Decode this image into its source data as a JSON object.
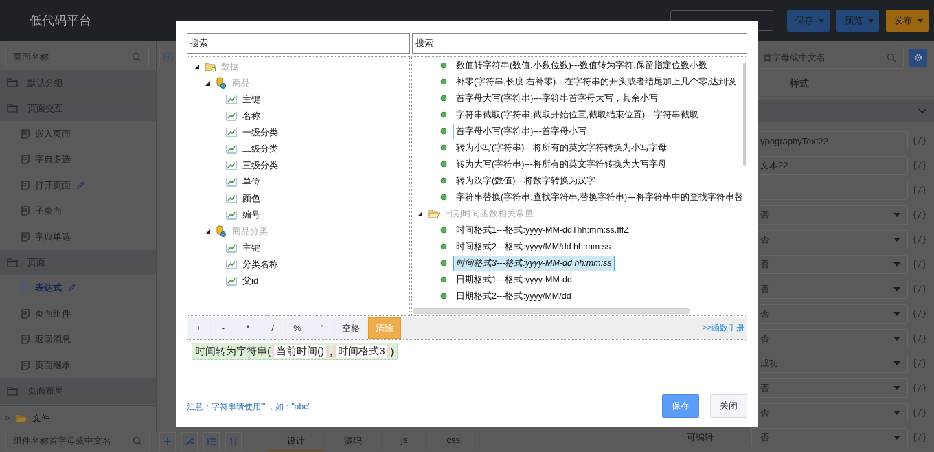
{
  "app": {
    "title": "低代码平台",
    "actions": [
      {
        "label": "保存",
        "kind": "primary"
      },
      {
        "label": "预览",
        "kind": "primary"
      },
      {
        "label": "发布",
        "kind": "warning"
      }
    ]
  },
  "sidebar": {
    "search_placeholder": "页面名称",
    "groups": [
      {
        "label": "默认分组"
      },
      {
        "label": "页面交互",
        "children": [
          {
            "label": "嵌入页面",
            "selected": false,
            "editing": false
          },
          {
            "label": "字典多选",
            "selected": false,
            "editing": false
          },
          {
            "label": "打开页面",
            "selected": false,
            "editing": true
          },
          {
            "label": "子页面",
            "selected": false,
            "editing": false
          },
          {
            "label": "字典单选",
            "selected": false,
            "editing": false
          }
        ]
      },
      {
        "label": "页面",
        "children": [
          {
            "label": "表达式",
            "selected": true,
            "editing": true
          },
          {
            "label": "页面组件",
            "selected": false,
            "editing": false
          },
          {
            "label": "返回消息",
            "selected": false,
            "editing": false
          },
          {
            "label": "页面继承",
            "selected": false,
            "editing": false
          }
        ]
      },
      {
        "label": "页面布局"
      }
    ],
    "file_node": {
      "label": "文件",
      "expanded": false
    },
    "component_search_placeholder": "组件名称首字母或中文名"
  },
  "editor_tabs": [
    {
      "label": "设计",
      "selected": true
    },
    {
      "label": "源码",
      "selected": false
    },
    {
      "label": "js",
      "selected": false
    },
    {
      "label": "css",
      "selected": false
    }
  ],
  "properties": {
    "search_placeholder": "首字母或中文名",
    "tabs": [
      {
        "label": "样式",
        "selected": false
      }
    ],
    "fields": [
      {
        "kind": "text",
        "value": "ypographyText22",
        "code_mark": "{/}"
      },
      {
        "kind": "text",
        "value": "文本22",
        "code_mark": "{/}"
      },
      {
        "kind": "text",
        "code_mark": "{/}"
      },
      {
        "kind": "select",
        "value": "否",
        "code_mark": "{/}"
      },
      {
        "kind": "select",
        "value": "否",
        "code_mark": "{/}"
      },
      {
        "kind": "select",
        "value": "否",
        "code_mark": "{/}"
      },
      {
        "kind": "select",
        "value": "否",
        "code_mark": "{/}"
      },
      {
        "kind": "select",
        "value": "否",
        "code_mark": "{/}"
      },
      {
        "kind": "select",
        "value": "否",
        "code_mark": "{/}"
      },
      {
        "kind": "select",
        "value": "成功",
        "code_mark": "{/}"
      },
      {
        "kind": "select",
        "value": "否",
        "code_mark": "{/}"
      },
      {
        "kind": "select",
        "value": "否",
        "code_mark": "{/}"
      },
      {
        "kind": "select",
        "label": "可编辑",
        "value": "否",
        "code_mark": "{/}"
      }
    ]
  },
  "dialog": {
    "left_search": {
      "placeholder": "搜索"
    },
    "right_search": {
      "placeholder": "搜索"
    },
    "tree": [
      {
        "label": "数据",
        "kind": "folder",
        "expanded": true,
        "children": [
          {
            "label": "商品",
            "kind": "table",
            "expanded": true,
            "children": [
              {
                "label": "主键",
                "kind": "field"
              },
              {
                "label": "名称",
                "kind": "field"
              },
              {
                "label": "一级分类",
                "kind": "field"
              },
              {
                "label": "二级分类",
                "kind": "field"
              },
              {
                "label": "三级分类",
                "kind": "field"
              },
              {
                "label": "单位",
                "kind": "field"
              },
              {
                "label": "颜色",
                "kind": "field"
              },
              {
                "label": "编号",
                "kind": "field"
              }
            ]
          },
          {
            "label": "商品分类",
            "kind": "table",
            "expanded": true,
            "children": [
              {
                "label": "主键",
                "kind": "field"
              },
              {
                "label": "分类名称",
                "kind": "field"
              },
              {
                "label": "父id",
                "kind": "field"
              }
            ]
          }
        ]
      }
    ],
    "function_groups": [
      {
        "children": [
          {
            "label": "数值转字符串(数值,小数位数)---数值转为字符,保留指定位数小数",
            "selected": false,
            "hovered": false
          },
          {
            "label": "补零(字符串,长度,右补零)---在字符串的开头或者结尾加上几个零,达到设",
            "selected": false,
            "hovered": false
          },
          {
            "label": "首字母大写(字符串)---字符串首字母大写，其余小写",
            "selected": false,
            "hovered": false
          },
          {
            "label": "字符串截取(字符串,截取开始位置,截取结束位置)---字符串截取",
            "selected": false,
            "hovered": false
          },
          {
            "label": "首字母小写(字符串)---首字母小写",
            "selected": false,
            "hovered": true
          },
          {
            "label": "转为小写(字符串)---将所有的英文字符转换为小写字母",
            "selected": false,
            "hovered": false
          },
          {
            "label": "转为大写(字符串)---将所有的英文字符转换为大写字母",
            "selected": false,
            "hovered": false
          },
          {
            "label": "转为汉字(数值)---将数字转换为汉字",
            "selected": false,
            "hovered": false
          },
          {
            "label": "字符串替换(字符串,查找字符串,替换字符串)---将字符串中的查找字符串替",
            "selected": false,
            "hovered": false
          }
        ]
      },
      {
        "label": "日期时间函数相关常量",
        "expanded": true,
        "children": [
          {
            "label": "时间格式1---格式:yyyy-MM-ddThh:mm:ss.fffZ",
            "selected": false,
            "hovered": false
          },
          {
            "label": "时间格式2---格式:yyyy/MM/dd hh:mm:ss",
            "selected": false,
            "hovered": false
          },
          {
            "label": "时间格式3---格式:yyyy-MM-dd hh:mm:ss",
            "selected": true,
            "hovered": false
          },
          {
            "label": "日期格式1---格式:yyyy-MM-dd",
            "selected": false,
            "hovered": false
          },
          {
            "label": "日期格式2---格式:yyyy/MM/dd",
            "selected": false,
            "hovered": false
          }
        ]
      }
    ],
    "operators": [
      {
        "label": "+",
        "kind": "operator"
      },
      {
        "label": "-",
        "kind": "operator"
      },
      {
        "label": "*",
        "kind": "operator"
      },
      {
        "label": "/",
        "kind": "operator"
      },
      {
        "label": "%",
        "kind": "operator"
      },
      {
        "label": "\"",
        "kind": "operator"
      },
      {
        "label": "空格",
        "kind": "operator"
      },
      {
        "label": "清除",
        "kind": "clear"
      }
    ],
    "manual_link": ">>函数手册",
    "expression": {
      "head": "时间转为字符串(",
      "args": [
        "当前时间()",
        "时间格式3"
      ],
      "separator": ",",
      "close": ")"
    },
    "note": "注意：字符串请使用\"\"，如：\"abc\"",
    "buttons": [
      {
        "label": "保存",
        "kind": "primary"
      },
      {
        "label": "关闭",
        "kind": "default"
      }
    ]
  }
}
